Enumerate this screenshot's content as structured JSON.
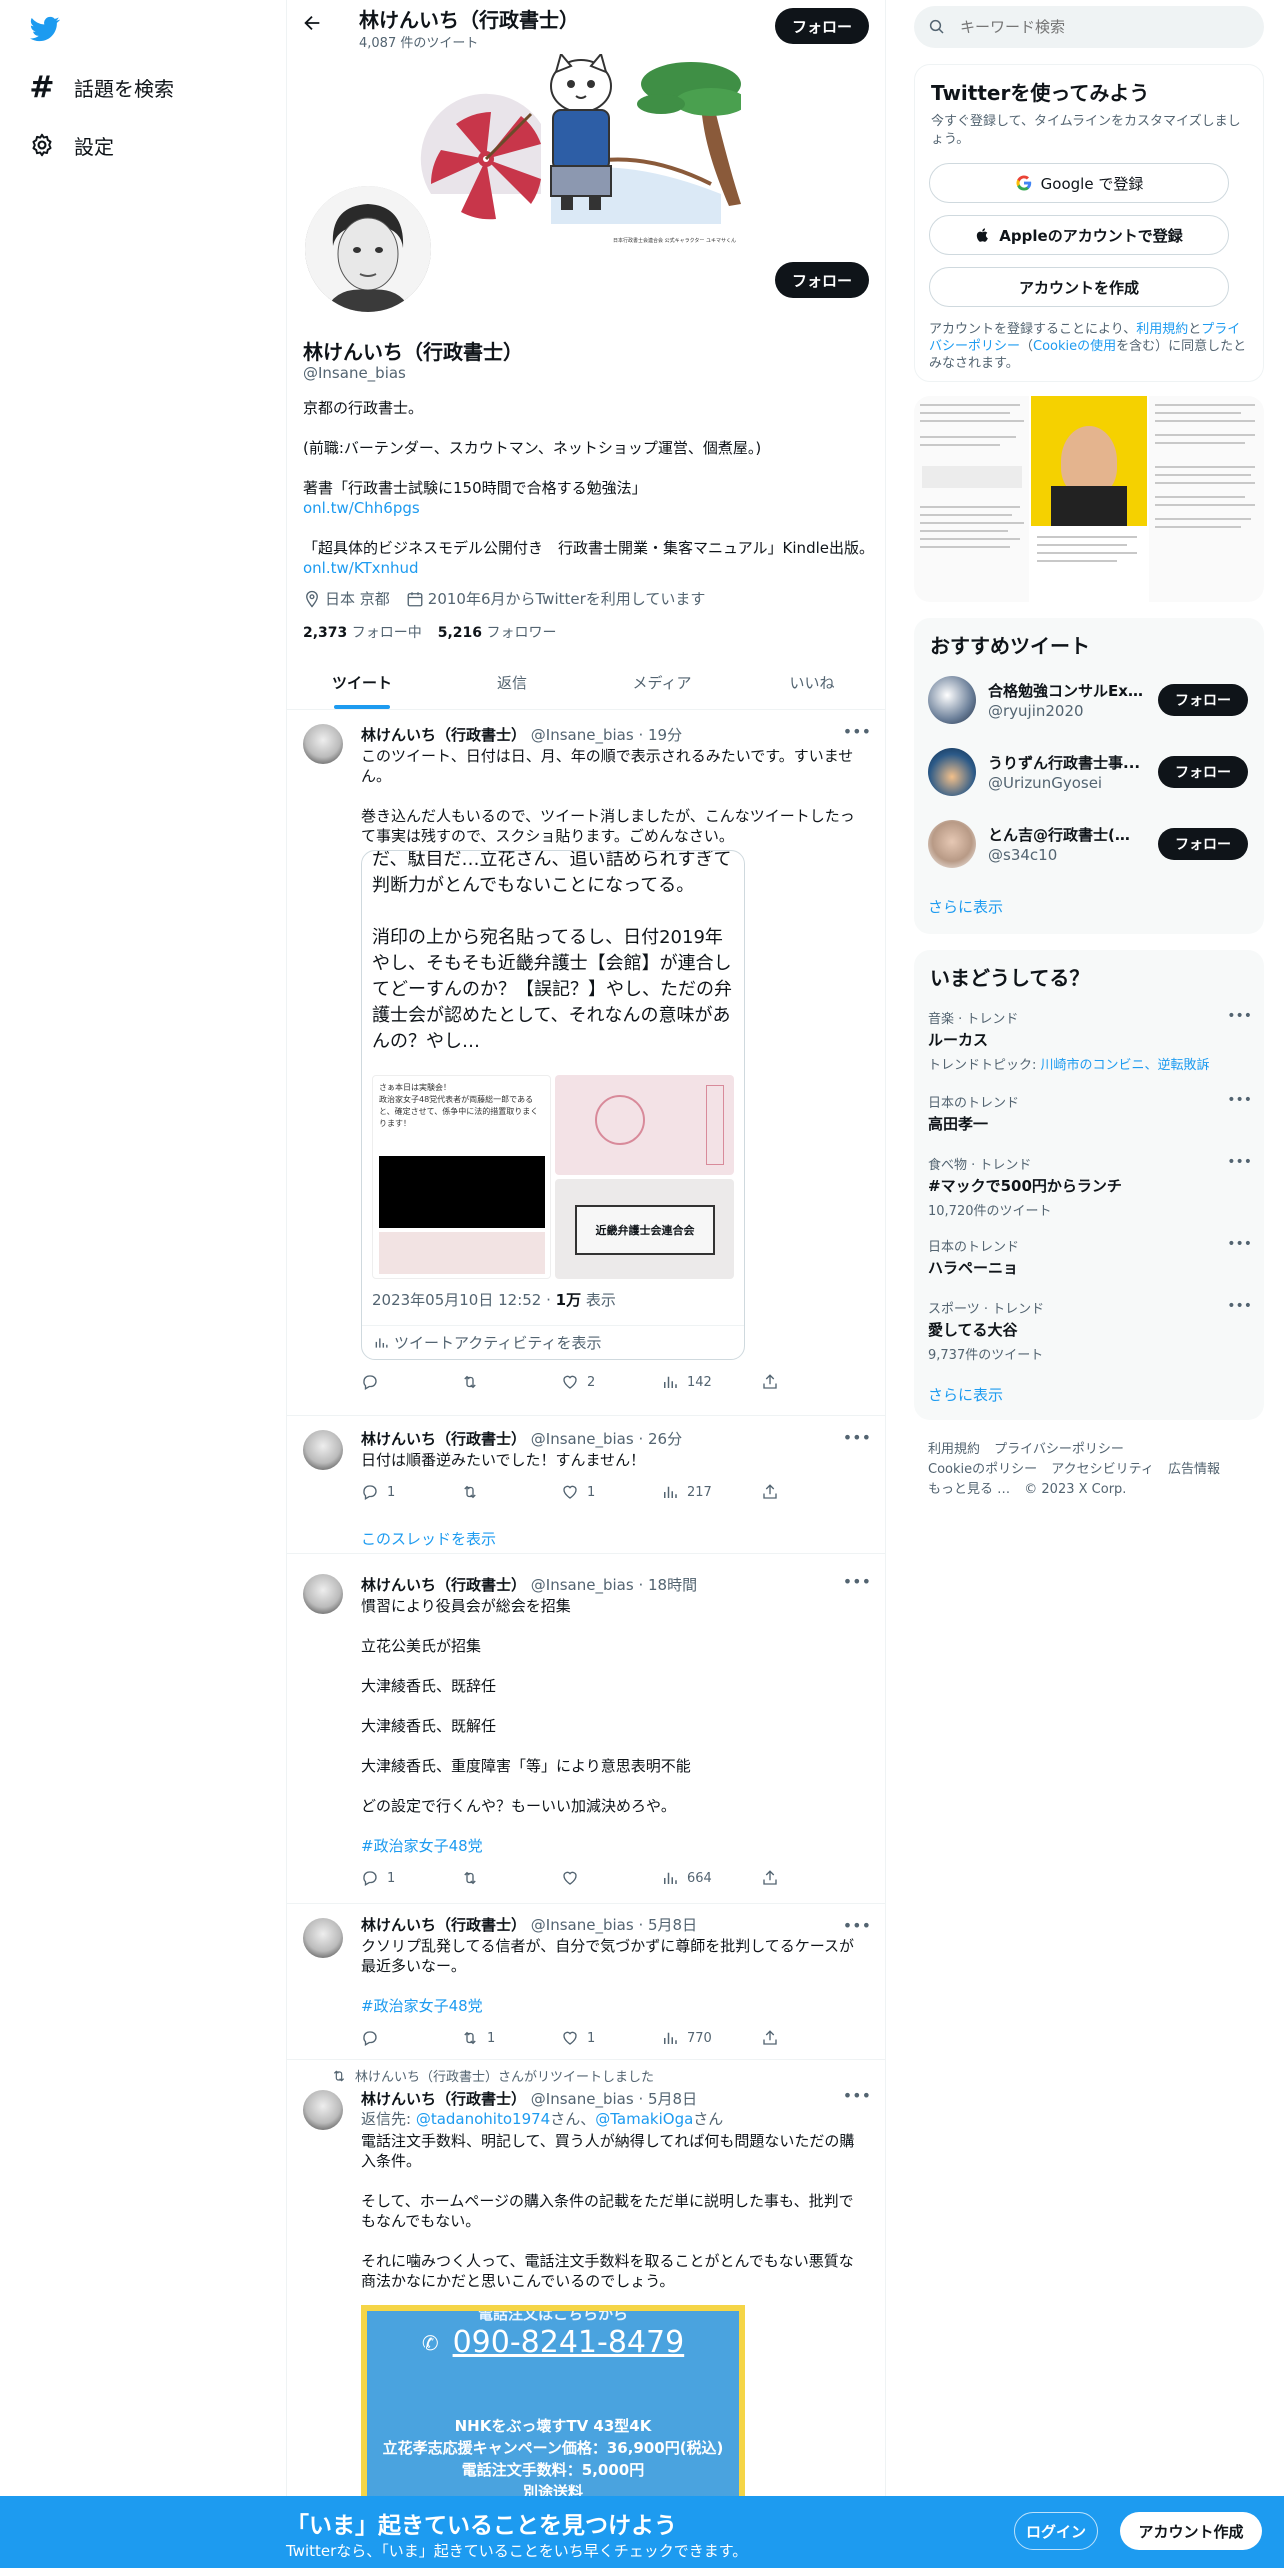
{
  "nav": {
    "explore_label": "話題を検索",
    "settings_label": "設定"
  },
  "header": {
    "title": "林けんいち（行政書士）",
    "tweet_count": "4,087 件のツイート",
    "follow_label": "フォロー"
  },
  "banner": {
    "caption": "日本行政書士会連合会 公式キャラクター ユキマサくん"
  },
  "profile": {
    "name": "林けんいち（行政書士）",
    "handle": "@Insane_bias",
    "follow_label": "フォロー",
    "bio_line1": "京都の行政書士。",
    "bio_line2": "(前職:バーテンダー、スカウトマン、ネットショップ運営、個煮屋。)",
    "bio_line3": "著書「行政書士試験に150時間で合格する勉強法」",
    "bio_link1": "onl.tw/Chh6pgs",
    "bio_line4": "「超具体的ビジネスモデル公開付き　行政書士開業・集客マニュアル」Kindle出版。",
    "bio_link2": "onl.tw/KTxnhud",
    "location": "日本 京都",
    "joined": "2010年6月からTwitterを利用しています",
    "following_count": "2,373",
    "following_label": "フォロー中",
    "followers_count": "5,216",
    "followers_label": "フォロワー"
  },
  "tabs": [
    "ツイート",
    "返信",
    "メディア",
    "いいね"
  ],
  "tweets": [
    {
      "name": "林けんいち（行政書士）",
      "handle": "@Insane_bias",
      "time": "· 19分",
      "text1": "このツイート、日付は日、月、年の順で表示されるみたいです。すいません。",
      "text2": "巻き込んだ人もいるので、ツイート消しましたが、こんなツイートしたって事実は残すので、スクショ貼ります。ごめんなさい。",
      "quote": {
        "line1": "だ、駄目だ…立花さん、追い詰められすぎて判断力がとんでもないことになってる。",
        "line2": "消印の上から宛名貼ってるし、日付2019年やし、そもそも近畿弁護士【会館】が連合してどーすんのか？【誤記？】やし、ただの弁護士会が認めたとして、それなんの意味があんの？やし…",
        "img1_text": "さぁ本日は実験会！\n政治家女子48党代表者が両藤総一郎であると、確定させて、係争中に法的措置取りまくります！",
        "img4_text": "近畿弁護士会連合会",
        "timestamp": "2023年05月10日 12:52 · ",
        "views_num": "1万",
        "views_label": " 表示",
        "activity_label": "ツイートアクティビティを表示"
      },
      "reply_count": "",
      "retweet_count": "",
      "like_count": "2",
      "view_count": "142"
    },
    {
      "name": "林けんいち（行政書士）",
      "handle": "@Insane_bias",
      "time": "· 26分",
      "text1": "日付は順番逆みたいでした！すんません！",
      "reply_count": "1",
      "retweet_count": "",
      "like_count": "1",
      "view_count": "217",
      "thread_link": "このスレッドを表示"
    },
    {
      "name": "林けんいち（行政書士）",
      "handle": "@Insane_bias",
      "time": "· 18時間",
      "text1": "慣習により役員会が総会を招集",
      "text2": "立花公美氏が招集",
      "text3": "大津綾香氏、既辞任",
      "text4": "大津綾香氏、既解任",
      "text5": "大津綾香氏、重度障害「等」により意思表明不能",
      "text6": "どの設定で行くんや？もーいい加減決めろや。",
      "hashtag": "#政治家女子48党",
      "reply_count": "1",
      "retweet_count": "",
      "like_count": "",
      "view_count": "664"
    },
    {
      "name": "林けんいち（行政書士）",
      "handle": "@Insane_bias",
      "time": "· 5月8日",
      "text1": "クソリプ乱発してる信者が、自分で気づかずに尊師を批判してるケースが最近多いなー。",
      "hashtag": "#政治家女子48党",
      "reply_count": "",
      "retweet_count": "1",
      "like_count": "1",
      "view_count": "770"
    },
    {
      "retweeted_by": "林けんいち（行政書士）さんがリツイートしました",
      "name": "林けんいち（行政書士）",
      "handle": "@Insane_bias",
      "time": "· 5月8日",
      "reply_prefix": "返信先: ",
      "reply_to1": "@tadanohito1974",
      "reply_sep": "さん、",
      "reply_to2": "@TamakiOga",
      "reply_suffix": "さん",
      "text1": "電話注文手数料、明記して、買う人が納得してれば何も問題ないただの購入条件。",
      "text2": "そして、ホームページの購入条件の記載をただ単に説明した事も、批判でもなんでもない。",
      "text3": "それに噛みつく人って、電話注文手数料を取ることがとんでもない悪質な商法かなにかだと思いこんでいるのでしょう。",
      "card": {
        "top_text": "電話注文はこちらから",
        "phone": "090-8241-8479",
        "line1": "NHKをぶっ壊すTV 43型4K",
        "line2": "立花孝志応援キャンペーン価格：36,900円(税込)",
        "line3": "電話注文手数料：5,000円",
        "line4": "別途送料"
      }
    }
  ],
  "right": {
    "search_placeholder": "キーワード検索",
    "signup_title": "Twitterを使ってみよう",
    "signup_sub": "今すぐ登録して、タイムラインをカスタマイズしましょう。",
    "google_label": "Google で登録",
    "apple_label": "Appleのアカウントで登録",
    "create_label": "アカウントを作成",
    "terms_pre": "アカウントを登録することにより、",
    "terms_link1": "利用規約",
    "terms_mid1": "と",
    "terms_link2": "プライバシーポリシー",
    "terms_paren_open": "（",
    "terms_link3": "Cookieの使用",
    "terms_end": "を含む）に同意したとみなされます。",
    "recommend_title": "おすすめツイート",
    "recommend": [
      {
        "name": "合格勉強コンサルEx...",
        "handle": "@ryujin2020",
        "btn": "フォロー",
        "color": "#6b7f99"
      },
      {
        "name": "うりずん行政書士事...",
        "handle": "@UrizunGyosei",
        "btn": "フォロー",
        "color": "#2c5a88"
      },
      {
        "name": "とん吉@行政書士(愛...",
        "handle": "@s34c10",
        "btn": "フォロー",
        "color": "#b89a86"
      }
    ],
    "recommend_more": "さらに表示",
    "trends_title": "いまどうしてる？",
    "trends": [
      {
        "cat": "音楽 · トレンド",
        "title": "ルーカス",
        "sub_pre": "トレンドトピック: ",
        "sub_link": "川崎市のコンビニ、逆転敗訴"
      },
      {
        "cat": "日本のトレンド",
        "title": "高田孝一"
      },
      {
        "cat": "食べ物 · トレンド",
        "title": "#マックで500円からランチ",
        "sub": "10,720件のツイート"
      },
      {
        "cat": "日本のトレンド",
        "title": "ハラペーニョ"
      },
      {
        "cat": "スポーツ · トレンド",
        "title": "愛してる大谷",
        "sub": "9,737件のツイート"
      }
    ],
    "trends_more": "さらに表示",
    "footer": [
      "利用規約",
      "プライバシーポリシー",
      "Cookieのポリシー",
      "アクセシビリティ",
      "広告情報",
      "もっと見る …",
      "© 2023 X Corp."
    ]
  },
  "bottom": {
    "title": "「いま」起きていることを見つけよう",
    "sub": "Twitterなら、「いま」起きていることをいち早くチェックできます。",
    "login": "ログイン",
    "signup": "アカウント作成"
  },
  "colors": {
    "accent": "#1d9bf0",
    "text": "#0f1419",
    "muted": "#536471",
    "card_blue": "#4aa3df",
    "card_border": "#f5d547"
  },
  "icons": [
    "twitter-bird-icon",
    "hashtag-icon",
    "gear-icon",
    "back-arrow-icon",
    "location-icon",
    "calendar-icon",
    "reply-icon",
    "retweet-icon",
    "like-icon",
    "views-icon",
    "share-icon",
    "more-icon",
    "search-icon",
    "google-icon",
    "apple-icon",
    "chart-icon",
    "phone-icon"
  ]
}
